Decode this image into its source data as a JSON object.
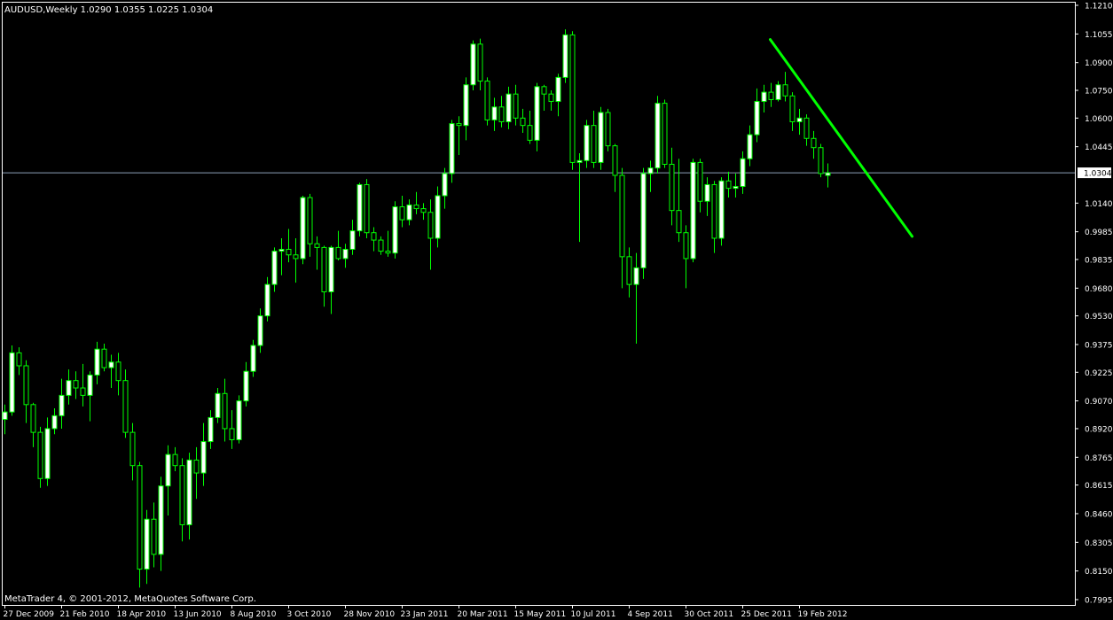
{
  "header": {
    "symbol_line": "AUDUSD,Weekly  1.0290 1.0355 1.0225 1.0304"
  },
  "footer": {
    "copyright": "MetaTrader 4, © 2001-2012, MetaQuotes Software Corp."
  },
  "colors": {
    "background": "#000000",
    "frame": "#ffffff",
    "candle_wick": "#00ff00",
    "bull_body": "#ffffff",
    "bear_body": "#000000",
    "trendline": "#00ff00",
    "price_line": "#8ca0b8"
  },
  "chart_data": {
    "type": "candlestick",
    "symbol": "AUDUSD",
    "timeframe": "Weekly",
    "last_bar": {
      "open": 1.029,
      "high": 1.0355,
      "low": 1.0225,
      "close": 1.0304
    },
    "current_price_label": "1.0304",
    "current_price": 1.0304,
    "ylim": [
      0.7995,
      1.121
    ],
    "y_ticks": [
      "1.1210",
      "1.1055",
      "1.0900",
      "1.0750",
      "1.0600",
      "1.0445",
      "1.0140",
      "0.9985",
      "0.9835",
      "0.9680",
      "0.9530",
      "0.9375",
      "0.9225",
      "0.9070",
      "0.8920",
      "0.8765",
      "0.8615",
      "0.8460",
      "0.8305",
      "0.8150",
      "0.7995"
    ],
    "x_ticks": [
      {
        "label": "27 Dec 2009",
        "bar": 0
      },
      {
        "label": "21 Feb 2010",
        "bar": 8
      },
      {
        "label": "18 Apr 2010",
        "bar": 16
      },
      {
        "label": "13 Jun 2010",
        "bar": 24
      },
      {
        "label": "8 Aug 2010",
        "bar": 32
      },
      {
        "label": "3 Oct 2010",
        "bar": 40
      },
      {
        "label": "28 Nov 2010",
        "bar": 48
      },
      {
        "label": "23 Jan 2011",
        "bar": 56
      },
      {
        "label": "20 Mar 2011",
        "bar": 64
      },
      {
        "label": "15 May 2011",
        "bar": 72
      },
      {
        "label": "10 Jul 2011",
        "bar": 80
      },
      {
        "label": "4 Sep 2011",
        "bar": 88
      },
      {
        "label": "30 Oct 2011",
        "bar": 96
      },
      {
        "label": "25 Dec 2011",
        "bar": 104
      },
      {
        "label": "19 Feb 2012",
        "bar": 112
      }
    ],
    "candles": [
      [
        0.897,
        0.905,
        0.889,
        0.901
      ],
      [
        0.901,
        0.937,
        0.899,
        0.933
      ],
      [
        0.933,
        0.936,
        0.921,
        0.926
      ],
      [
        0.926,
        0.929,
        0.895,
        0.905
      ],
      [
        0.905,
        0.906,
        0.882,
        0.89
      ],
      [
        0.89,
        0.893,
        0.86,
        0.865
      ],
      [
        0.865,
        0.898,
        0.861,
        0.892
      ],
      [
        0.892,
        0.903,
        0.889,
        0.899
      ],
      [
        0.899,
        0.919,
        0.892,
        0.91
      ],
      [
        0.91,
        0.924,
        0.905,
        0.918
      ],
      [
        0.918,
        0.923,
        0.908,
        0.914
      ],
      [
        0.914,
        0.927,
        0.904,
        0.91
      ],
      [
        0.91,
        0.923,
        0.896,
        0.921
      ],
      [
        0.921,
        0.939,
        0.916,
        0.935
      ],
      [
        0.935,
        0.938,
        0.923,
        0.925
      ],
      [
        0.925,
        0.932,
        0.914,
        0.928
      ],
      [
        0.928,
        0.933,
        0.91,
        0.918
      ],
      [
        0.918,
        0.924,
        0.887,
        0.89
      ],
      [
        0.89,
        0.895,
        0.864,
        0.872
      ],
      [
        0.872,
        0.874,
        0.806,
        0.816
      ],
      [
        0.816,
        0.848,
        0.808,
        0.843
      ],
      [
        0.843,
        0.852,
        0.817,
        0.824
      ],
      [
        0.824,
        0.866,
        0.815,
        0.861
      ],
      [
        0.861,
        0.883,
        0.845,
        0.878
      ],
      [
        0.878,
        0.882,
        0.869,
        0.872
      ],
      [
        0.872,
        0.876,
        0.831,
        0.84
      ],
      [
        0.84,
        0.879,
        0.832,
        0.875
      ],
      [
        0.875,
        0.882,
        0.854,
        0.868
      ],
      [
        0.868,
        0.895,
        0.861,
        0.885
      ],
      [
        0.885,
        0.902,
        0.881,
        0.898
      ],
      [
        0.898,
        0.914,
        0.895,
        0.911
      ],
      [
        0.911,
        0.919,
        0.885,
        0.892
      ],
      [
        0.892,
        0.902,
        0.881,
        0.886
      ],
      [
        0.886,
        0.91,
        0.884,
        0.907
      ],
      [
        0.907,
        0.928,
        0.904,
        0.923
      ],
      [
        0.923,
        0.94,
        0.92,
        0.937
      ],
      [
        0.937,
        0.957,
        0.933,
        0.953
      ],
      [
        0.953,
        0.974,
        0.95,
        0.97
      ],
      [
        0.97,
        0.99,
        0.966,
        0.988
      ],
      [
        0.988,
        0.995,
        0.975,
        0.989
      ],
      [
        0.989,
        1.0,
        0.982,
        0.986
      ],
      [
        0.986,
        0.995,
        0.971,
        0.984
      ],
      [
        0.984,
        1.018,
        0.981,
        1.017
      ],
      [
        1.017,
        1.019,
        0.985,
        0.992
      ],
      [
        0.992,
        0.996,
        0.978,
        0.99
      ],
      [
        0.99,
        0.991,
        0.958,
        0.966
      ],
      [
        0.966,
        0.991,
        0.954,
        0.99
      ],
      [
        0.99,
        0.999,
        0.983,
        0.984
      ],
      [
        0.984,
        0.992,
        0.979,
        0.989
      ],
      [
        0.989,
        1.005,
        0.986,
        0.999
      ],
      [
        0.999,
        1.025,
        0.996,
        1.024
      ],
      [
        1.024,
        1.027,
        0.995,
        0.998
      ],
      [
        0.998,
        1.001,
        0.988,
        0.994
      ],
      [
        0.994,
        0.996,
        0.986,
        0.988
      ],
      [
        0.988,
        0.999,
        0.985,
        0.987
      ],
      [
        0.987,
        1.015,
        0.984,
        1.012
      ],
      [
        1.012,
        1.018,
        1.001,
        1.005
      ],
      [
        1.005,
        1.016,
        1.002,
        1.013
      ],
      [
        1.013,
        1.02,
        1.008,
        1.011
      ],
      [
        1.011,
        1.014,
        1.005,
        1.009
      ],
      [
        1.009,
        1.016,
        0.978,
        0.995
      ],
      [
        0.995,
        1.023,
        0.99,
        1.018
      ],
      [
        1.018,
        1.033,
        1.011,
        1.03
      ],
      [
        1.03,
        1.059,
        1.025,
        1.057
      ],
      [
        1.057,
        1.061,
        1.04,
        1.056
      ],
      [
        1.056,
        1.082,
        1.048,
        1.078
      ],
      [
        1.078,
        1.102,
        1.075,
        1.1
      ],
      [
        1.1,
        1.103,
        1.075,
        1.08
      ],
      [
        1.08,
        1.082,
        1.056,
        1.059
      ],
      [
        1.059,
        1.071,
        1.053,
        1.066
      ],
      [
        1.066,
        1.072,
        1.055,
        1.058
      ],
      [
        1.058,
        1.077,
        1.054,
        1.073
      ],
      [
        1.073,
        1.078,
        1.056,
        1.06
      ],
      [
        1.06,
        1.065,
        1.052,
        1.056
      ],
      [
        1.056,
        1.064,
        1.046,
        1.048
      ],
      [
        1.048,
        1.079,
        1.042,
        1.077
      ],
      [
        1.077,
        1.078,
        1.064,
        1.073
      ],
      [
        1.073,
        1.075,
        1.064,
        1.069
      ],
      [
        1.069,
        1.084,
        1.061,
        1.082
      ],
      [
        1.082,
        1.108,
        1.079,
        1.105
      ],
      [
        1.105,
        1.107,
        1.032,
        1.036
      ],
      [
        1.036,
        1.041,
        0.993,
        1.037
      ],
      [
        1.037,
        1.059,
        1.033,
        1.056
      ],
      [
        1.056,
        1.064,
        1.033,
        1.036
      ],
      [
        1.036,
        1.066,
        1.032,
        1.063
      ],
      [
        1.063,
        1.065,
        1.042,
        1.045
      ],
      [
        1.045,
        1.046,
        1.02,
        1.029
      ],
      [
        1.029,
        1.033,
        0.968,
        0.985
      ],
      [
        0.985,
        0.99,
        0.963,
        0.97
      ],
      [
        0.97,
        0.987,
        0.938,
        0.979
      ],
      [
        0.979,
        1.033,
        0.973,
        1.03
      ],
      [
        1.03,
        1.037,
        1.02,
        1.033
      ],
      [
        1.033,
        1.072,
        1.03,
        1.068
      ],
      [
        1.068,
        1.07,
        1.033,
        1.035
      ],
      [
        1.035,
        1.044,
        1.002,
        1.01
      ],
      [
        1.01,
        1.038,
        0.993,
        0.998
      ],
      [
        0.998,
        1.002,
        0.968,
        0.984
      ],
      [
        0.984,
        1.038,
        0.982,
        1.036
      ],
      [
        1.036,
        1.038,
        1.009,
        1.015
      ],
      [
        1.015,
        1.028,
        1.007,
        1.024
      ],
      [
        1.024,
        1.026,
        0.987,
        0.995
      ],
      [
        0.995,
        1.028,
        0.991,
        1.026
      ],
      [
        1.026,
        1.031,
        1.017,
        1.022
      ],
      [
        1.022,
        1.03,
        1.017,
        1.023
      ],
      [
        1.023,
        1.042,
        1.019,
        1.038
      ],
      [
        1.038,
        1.056,
        1.034,
        1.051
      ],
      [
        1.051,
        1.076,
        1.047,
        1.069
      ],
      [
        1.069,
        1.078,
        1.063,
        1.074
      ],
      [
        1.074,
        1.079,
        1.066,
        1.07
      ],
      [
        1.07,
        1.08,
        1.069,
        1.078
      ],
      [
        1.078,
        1.085,
        1.069,
        1.072
      ],
      [
        1.072,
        1.074,
        1.053,
        1.058
      ],
      [
        1.058,
        1.065,
        1.051,
        1.06
      ],
      [
        1.06,
        1.062,
        1.045,
        1.049
      ],
      [
        1.049,
        1.053,
        1.038,
        1.044
      ],
      [
        1.044,
        1.046,
        1.028,
        1.03
      ],
      [
        1.029,
        1.0355,
        1.0225,
        1.0304
      ]
    ],
    "trendline": {
      "from": {
        "bar": 108,
        "price": 1.1025
      },
      "to": {
        "bar": 128,
        "price": 0.996
      }
    },
    "grid": false,
    "legend": "none"
  }
}
